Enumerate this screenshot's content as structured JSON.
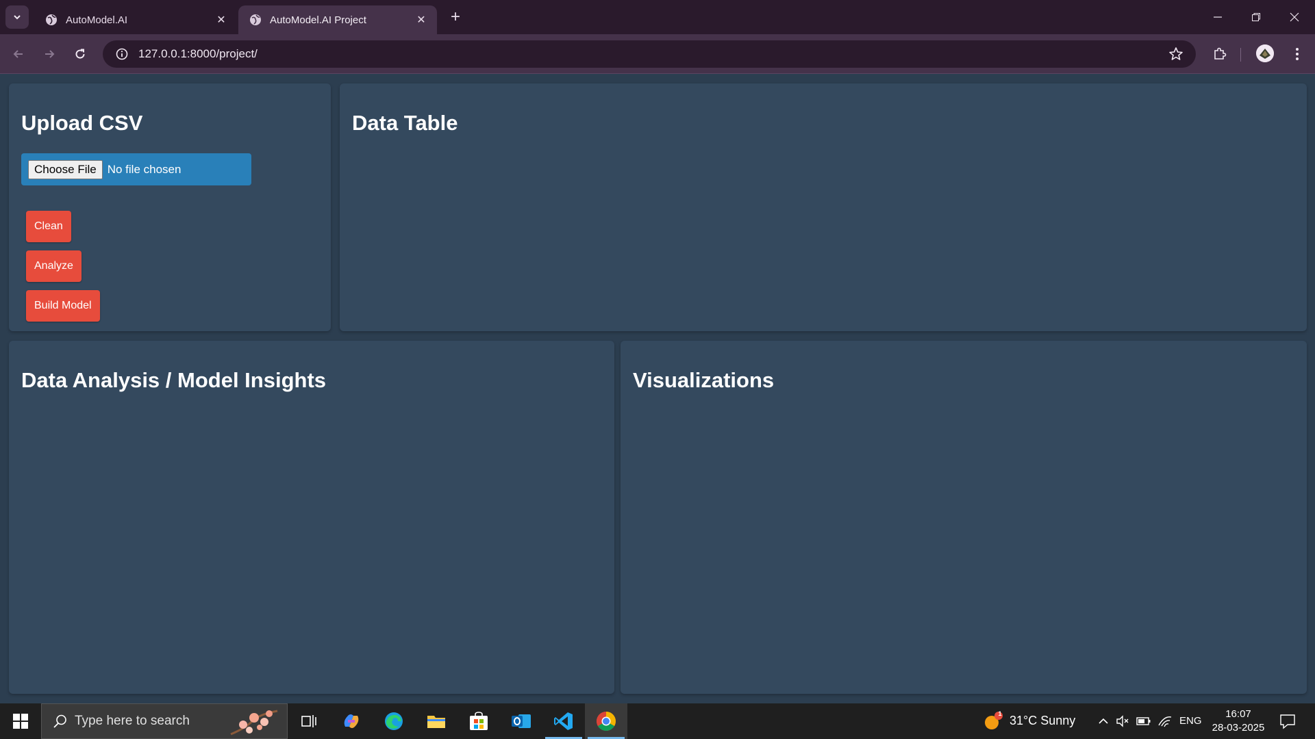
{
  "browser": {
    "tabs": [
      {
        "title": "AutoModel.AI",
        "active": false
      },
      {
        "title": "AutoModel.AI Project",
        "active": true
      }
    ],
    "url": "127.0.0.1:8000/project/"
  },
  "upload_panel": {
    "heading": "Upload CSV",
    "file_button": "Choose File",
    "file_status": "No file chosen",
    "buttons": {
      "clean": "Clean",
      "analyze": "Analyze",
      "build": "Build Model"
    }
  },
  "table_panel": {
    "heading": "Data Table"
  },
  "analysis_panel": {
    "heading": "Data Analysis / Model Insights"
  },
  "viz_panel": {
    "heading": "Visualizations"
  },
  "taskbar": {
    "search_placeholder": "Type here to search",
    "weather": "31°C  Sunny",
    "weather_badge": "1",
    "language": "ENG",
    "time": "16:07",
    "date": "28-03-2025"
  },
  "colors": {
    "page_bg": "#2c3e50",
    "panel_bg": "#34495e",
    "file_input_bg": "#2980b9",
    "action_button": "#e74c3c"
  }
}
